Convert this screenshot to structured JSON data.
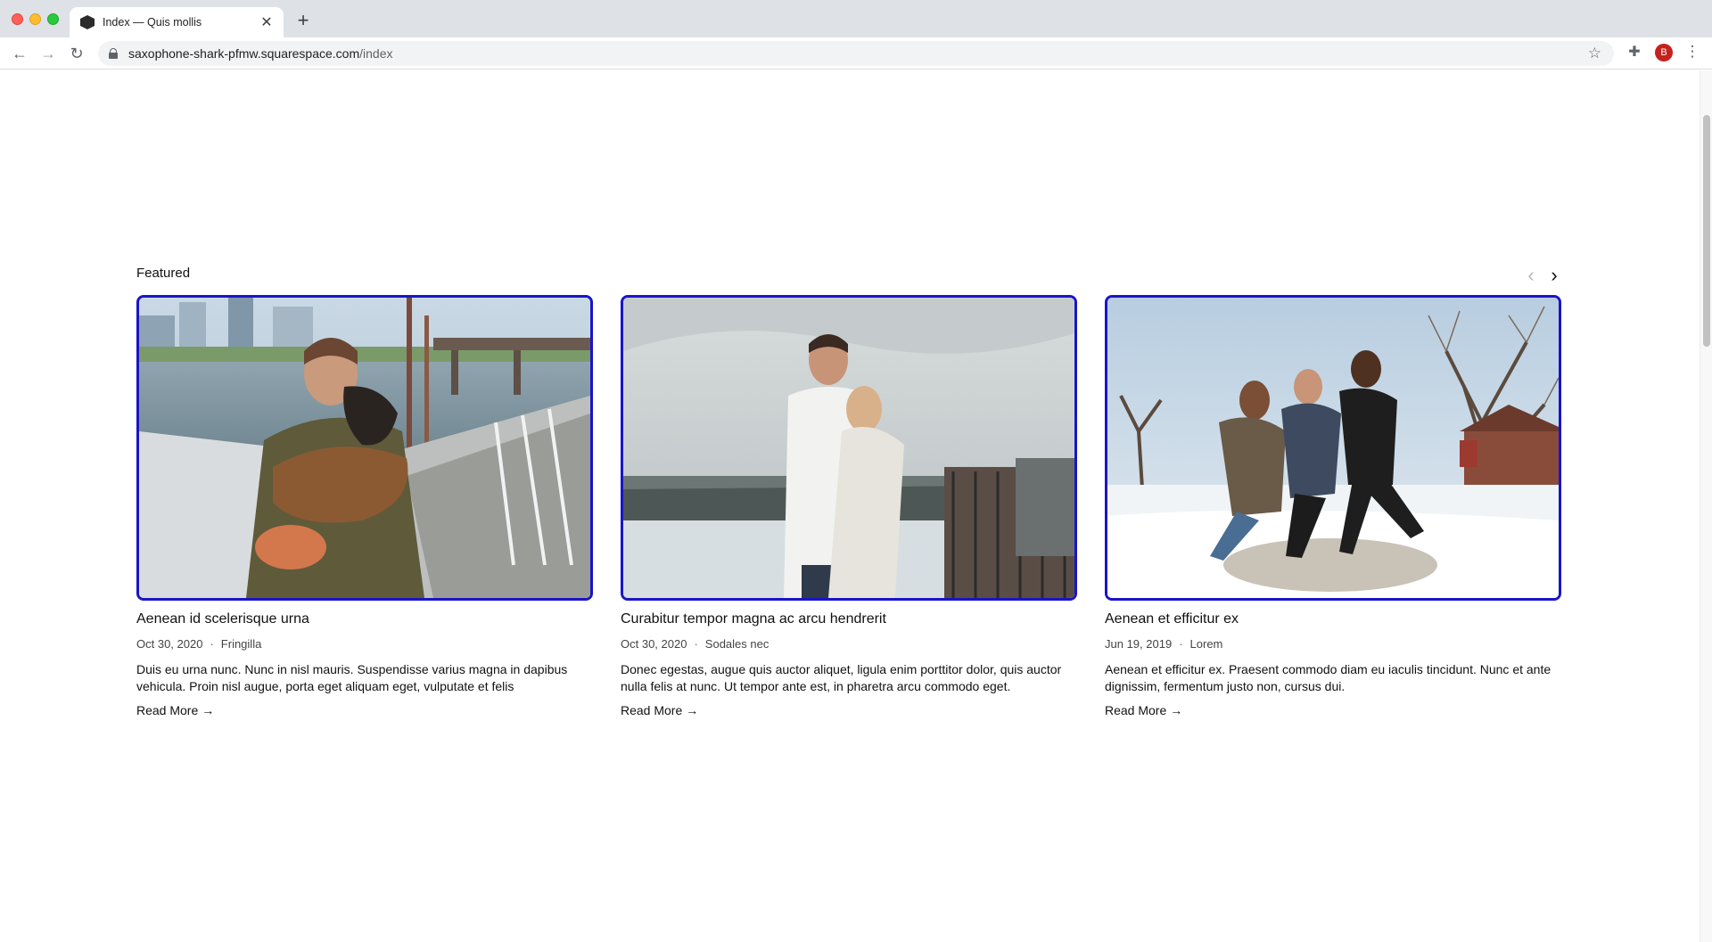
{
  "browser": {
    "tab_title": "Index — Quis mollis",
    "url_host": "saxophone-shark-pfmw.squarespace.com",
    "url_path": "/index",
    "avatar_letter": "B"
  },
  "section": {
    "title": "Featured"
  },
  "cards": [
    {
      "title": "Aenean id scelerisque urna",
      "date": "Oct 30, 2020",
      "category": "Fringilla",
      "excerpt": "Duis eu urna nunc. Nunc in nisl mauris. Suspendisse varius magna in dapibus vehicula. Proin nisl augue, porta eget aliquam eget, vulputate et felis",
      "read_more": "Read More",
      "image": "man-kissing-dog-on-pier-photo"
    },
    {
      "title": "Curabitur tempor magna ac arcu hendrerit",
      "date": "Oct 30, 2020",
      "category": "Sodales nec",
      "excerpt": "Donec egestas, augue quis auctor aliquet, ligula enim porttitor dolor, quis auctor nulla felis at nunc. Ut tempor ante est, in pharetra arcu commodo eget.",
      "read_more": "Read More",
      "image": "couple-hugging-on-rooftop-photo"
    },
    {
      "title": "Aenean et efficitur ex",
      "date": "Jun 19, 2019",
      "category": "Lorem",
      "excerpt": "Aenean et efficitur ex. Praesent commodo diam eu iaculis tincidunt. Nunc et ante dignissim, fermentum justo non, cursus dui.",
      "read_more": "Read More",
      "image": "friends-jumping-in-snow-photo"
    }
  ],
  "colors": {
    "card_border": "#1a14c8",
    "text": "#111111",
    "meta": "#444444"
  }
}
